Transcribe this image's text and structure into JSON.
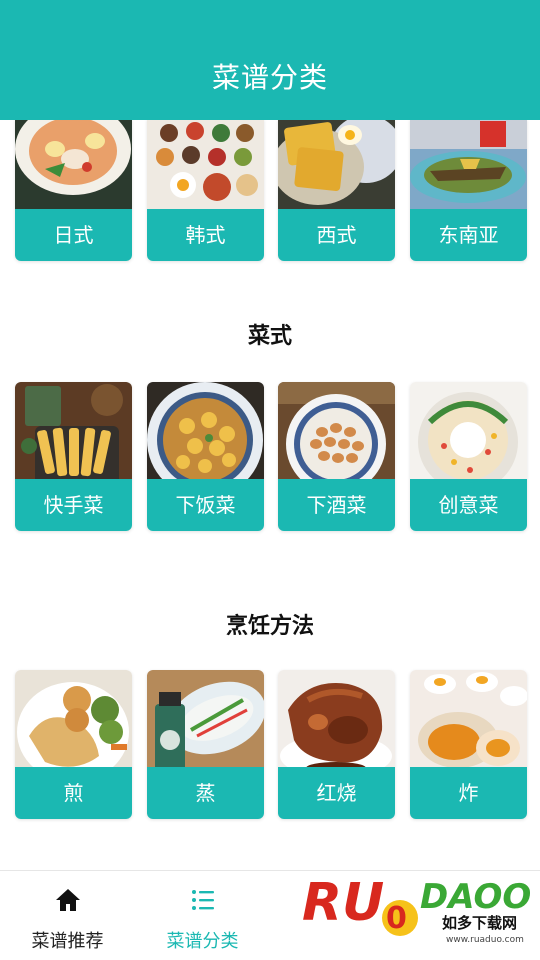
{
  "header": {
    "title": "菜谱分类"
  },
  "sections": [
    {
      "title": "",
      "items": [
        "日式",
        "韩式",
        "西式",
        "东南亚"
      ]
    },
    {
      "title": "菜式",
      "items": [
        "快手菜",
        "下饭菜",
        "下酒菜",
        "创意菜"
      ]
    },
    {
      "title": "烹饪方法",
      "items": [
        "煎",
        "蒸",
        "红烧",
        "炸"
      ]
    }
  ],
  "tabbar": {
    "items": [
      {
        "label": "菜谱推荐",
        "icon": "home-icon",
        "active": false
      },
      {
        "label": "菜谱分类",
        "icon": "list-icon",
        "active": true
      }
    ],
    "active_color": "#1bb8b2",
    "inactive_color": "#222222"
  },
  "watermark": {
    "text": "RUANDAO",
    "subtext": "如多下载网",
    "url": "www.ruaduo.com"
  },
  "colors": {
    "accent": "#1bb8b2"
  }
}
